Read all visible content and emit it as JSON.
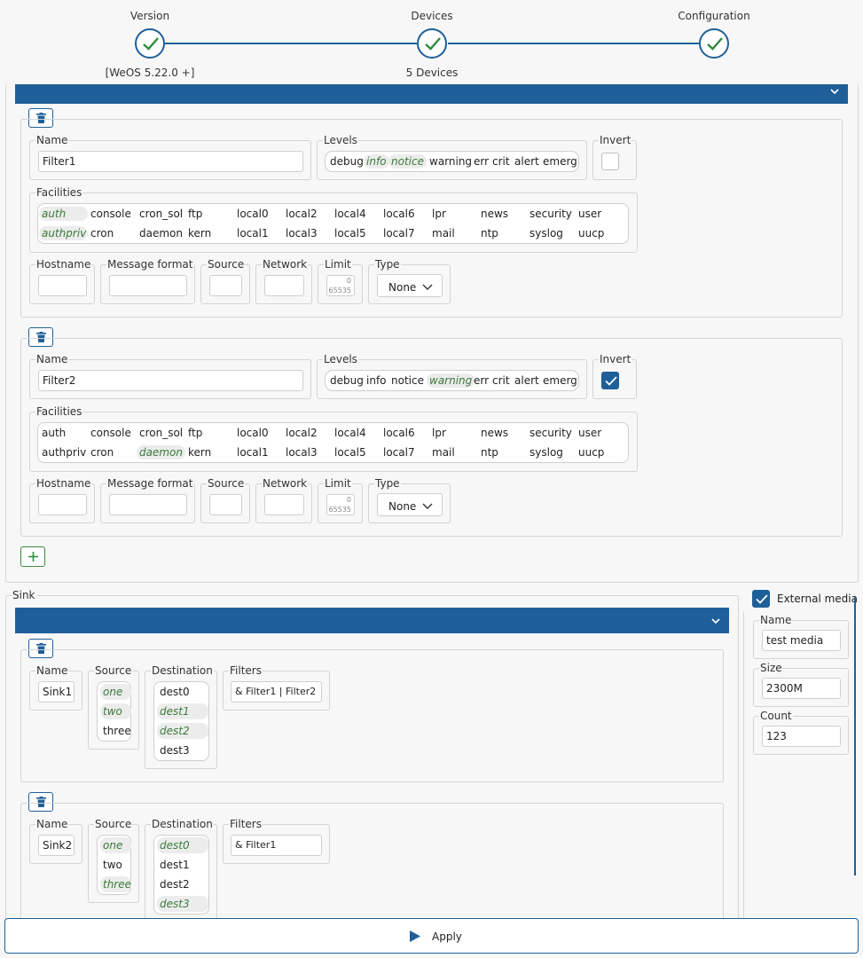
{
  "stepper": {
    "steps": [
      {
        "label": "Version",
        "sublabel": "[WeOS 5.22.0 +]"
      },
      {
        "label": "Devices",
        "sublabel": "5 Devices"
      },
      {
        "label": "Configuration",
        "sublabel": ""
      }
    ]
  },
  "labels": {
    "name": "Name",
    "levels": "Levels",
    "invert": "Invert",
    "facilities": "Facilities",
    "hostname": "Hostname",
    "message_format": "Message format",
    "source": "Source",
    "network": "Network",
    "limit": "Limit",
    "type": "Type",
    "sink": "Sink",
    "destination": "Destination",
    "filters": "Filters",
    "external_media": "External media",
    "size": "Size",
    "count": "Count",
    "apply": "Apply"
  },
  "levels": [
    "debug",
    "info",
    "notice",
    "warning",
    "err",
    "crit",
    "alert",
    "emerg"
  ],
  "facilities": {
    "row1": [
      "auth",
      "console",
      "cron_sol",
      "ftp",
      "local0",
      "local2",
      "local4",
      "local6",
      "lpr",
      "news",
      "security",
      "user"
    ],
    "row2": [
      "authpriv",
      "cron",
      "daemon",
      "kern",
      "local1",
      "local3",
      "local5",
      "local7",
      "mail",
      "ntp",
      "syslog",
      "uucp"
    ]
  },
  "filters": [
    {
      "name": "Filter1",
      "invert": false,
      "selected_levels": [
        "info",
        "notice"
      ],
      "selected_facilities": [
        "auth",
        "authpriv"
      ],
      "limit_min": "0",
      "limit_max": "65535",
      "type": "None"
    },
    {
      "name": "Filter2",
      "invert": true,
      "selected_levels": [
        "warning"
      ],
      "selected_facilities": [
        "daemon"
      ],
      "limit_min": "0",
      "limit_max": "65535",
      "type": "None"
    }
  ],
  "sink_sources": [
    "one",
    "two",
    "three"
  ],
  "sink_destinations": [
    "dest0",
    "dest1",
    "dest2",
    "dest3"
  ],
  "sinks": [
    {
      "name": "Sink1",
      "selected_sources": [
        "one",
        "two"
      ],
      "selected_destinations": [
        "dest1",
        "dest2"
      ],
      "filters": "& Filter1 | Filter2"
    },
    {
      "name": "Sink2",
      "selected_sources": [
        "one",
        "three"
      ],
      "selected_destinations": [
        "dest0",
        "dest3"
      ],
      "filters": "& Filter1"
    }
  ],
  "external_media": {
    "enabled": true,
    "name": "test media",
    "size": "2300M",
    "count": "123"
  },
  "colors": {
    "primary": "#1f5f99",
    "selected_text": "#3b7a3b",
    "background": "#f7f7f7"
  }
}
